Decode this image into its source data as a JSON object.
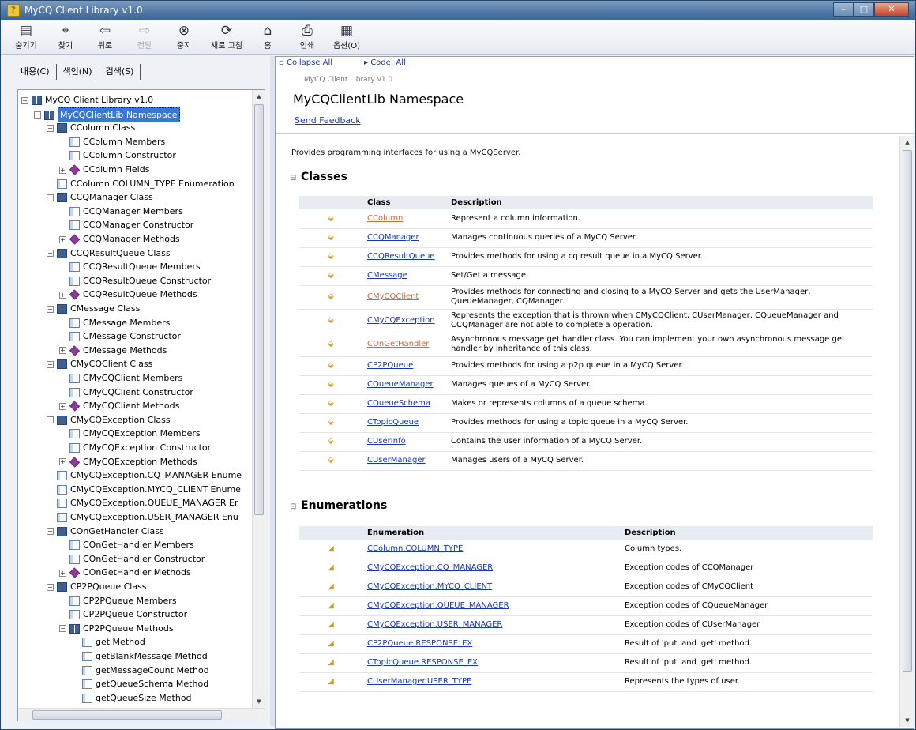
{
  "window": {
    "title": "MyCQ Client Library v1.0",
    "min": "–",
    "max": "□",
    "close": "✕"
  },
  "toolbar": {
    "buttons": [
      {
        "label": "숨기기",
        "icon": "hide-icon",
        "glyph": "▤"
      },
      {
        "label": "찾기",
        "icon": "locate-icon",
        "glyph": "⌖"
      },
      {
        "label": "뒤로",
        "icon": "back-icon",
        "glyph": "⇦"
      },
      {
        "label": "전달",
        "icon": "forward-icon",
        "glyph": "⇨"
      },
      {
        "label": "중지",
        "icon": "stop-icon",
        "glyph": "⊗"
      },
      {
        "label": "새로 고침",
        "icon": "refresh-icon",
        "glyph": "⟳"
      },
      {
        "label": "홈",
        "icon": "home-icon",
        "glyph": "⌂"
      },
      {
        "label": "인쇄",
        "icon": "print-icon",
        "glyph": "⎙"
      },
      {
        "label": "옵션(O)",
        "icon": "options-icon",
        "glyph": "▦"
      }
    ]
  },
  "nav_tabs": [
    "내용(C)",
    "색인(N)",
    "검색(S)"
  ],
  "tree": [
    {
      "d": 0,
      "type": "book",
      "exp": "−",
      "label": "MyCQ Client Library v1.0"
    },
    {
      "d": 1,
      "type": "book",
      "exp": "−",
      "label": "MyCQClientLib Namespace",
      "selected": true
    },
    {
      "d": 2,
      "type": "book",
      "exp": "−",
      "label": "CColumn Class"
    },
    {
      "d": 3,
      "type": "page",
      "label": "CColumn Members"
    },
    {
      "d": 3,
      "type": "page",
      "label": "CColumn Constructor"
    },
    {
      "d": 3,
      "type": "gem",
      "exp": "+",
      "label": "CColumn Fields"
    },
    {
      "d": 2,
      "type": "page",
      "label": "CColumn.COLUMN_TYPE Enumeration"
    },
    {
      "d": 2,
      "type": "book",
      "exp": "−",
      "label": "CCQManager Class"
    },
    {
      "d": 3,
      "type": "page",
      "label": "CCQManager Members"
    },
    {
      "d": 3,
      "type": "page",
      "label": "CCQManager Constructor"
    },
    {
      "d": 3,
      "type": "gem",
      "exp": "+",
      "label": "CCQManager Methods"
    },
    {
      "d": 2,
      "type": "book",
      "exp": "−",
      "label": "CCQResultQueue Class"
    },
    {
      "d": 3,
      "type": "page",
      "label": "CCQResultQueue Members"
    },
    {
      "d": 3,
      "type": "page",
      "label": "CCQResultQueue Constructor"
    },
    {
      "d": 3,
      "type": "gem",
      "exp": "+",
      "label": "CCQResultQueue Methods"
    },
    {
      "d": 2,
      "type": "book",
      "exp": "−",
      "label": "CMessage Class"
    },
    {
      "d": 3,
      "type": "page",
      "label": "CMessage Members"
    },
    {
      "d": 3,
      "type": "page",
      "label": "CMessage Constructor"
    },
    {
      "d": 3,
      "type": "gem",
      "exp": "+",
      "label": "CMessage Methods"
    },
    {
      "d": 2,
      "type": "book",
      "exp": "−",
      "label": "CMyCQClient Class"
    },
    {
      "d": 3,
      "type": "page",
      "label": "CMyCQClient Members"
    },
    {
      "d": 3,
      "type": "page",
      "label": "CMyCQClient Constructor"
    },
    {
      "d": 3,
      "type": "gem",
      "exp": "+",
      "label": "CMyCQClient Methods"
    },
    {
      "d": 2,
      "type": "book",
      "exp": "−",
      "label": "CMyCQException Class"
    },
    {
      "d": 3,
      "type": "page",
      "label": "CMyCQException Members"
    },
    {
      "d": 3,
      "type": "page",
      "label": "CMyCQException Constructor"
    },
    {
      "d": 3,
      "type": "gem",
      "exp": "+",
      "label": "CMyCQException Methods"
    },
    {
      "d": 2,
      "type": "page",
      "label": "CMyCQException.CQ_MANAGER Enume"
    },
    {
      "d": 2,
      "type": "page",
      "label": "CMyCQException.MYCQ_CLIENT Enume"
    },
    {
      "d": 2,
      "type": "page",
      "label": "CMyCQException.QUEUE_MANAGER Er"
    },
    {
      "d": 2,
      "type": "page",
      "label": "CMyCQException.USER_MANAGER Enu"
    },
    {
      "d": 2,
      "type": "book",
      "exp": "−",
      "label": "COnGetHandler Class"
    },
    {
      "d": 3,
      "type": "page",
      "label": "COnGetHandler Members"
    },
    {
      "d": 3,
      "type": "page",
      "label": "COnGetHandler Constructor"
    },
    {
      "d": 3,
      "type": "gem",
      "exp": "+",
      "label": "COnGetHandler Methods"
    },
    {
      "d": 2,
      "type": "book",
      "exp": "−",
      "label": "CP2PQueue Class"
    },
    {
      "d": 3,
      "type": "page",
      "label": "CP2PQueue Members"
    },
    {
      "d": 3,
      "type": "page",
      "label": "CP2PQueue Constructor"
    },
    {
      "d": 3,
      "type": "book",
      "exp": "−",
      "label": "CP2PQueue Methods"
    },
    {
      "d": 4,
      "type": "page",
      "label": "get Method"
    },
    {
      "d": 4,
      "type": "page",
      "label": "getBlankMessage Method"
    },
    {
      "d": 4,
      "type": "page",
      "label": "getMessageCount Method"
    },
    {
      "d": 4,
      "type": "page",
      "label": "getQueueSchema Method"
    },
    {
      "d": 4,
      "type": "page",
      "label": "getQueueSize Method"
    }
  ],
  "content": {
    "collapse_all": "Collapse All",
    "code_all": "Code: All",
    "library": "MyCQ Client Library v1.0",
    "title": "MyCQClientLib Namespace",
    "feedback": "Send Feedback",
    "intro": "Provides programming interfaces for using a MyCQServer.",
    "classes_heading": "Classes",
    "classes_cols": [
      "Class",
      "Description"
    ],
    "classes": [
      {
        "name": "CColumn",
        "desc": "Represent a column information.",
        "visited": true
      },
      {
        "name": "CCQManager",
        "desc": "Manages continuous queries of a MyCQ Server."
      },
      {
        "name": "CCQResultQueue",
        "desc": "Provides methods for using a cq result queue in a MyCQ Server."
      },
      {
        "name": "CMessage",
        "desc": "Set/Get a message."
      },
      {
        "name": "CMyCQClient",
        "desc": "Provides methods for connecting and closing to a MyCQ Server and gets the UserManager, QueueManager, CQManager.",
        "visited": true
      },
      {
        "name": "CMyCQException",
        "desc": "Represents the exception that is thrown when CMyCQClient, CUserManager, CQueueManager and CCQManager are not able to complete a operation."
      },
      {
        "name": "COnGetHandler",
        "desc": "Asynchronous message get handler class. You can implement your own asynchronous message get handler by inheritance of this class.",
        "visited": true
      },
      {
        "name": "CP2PQueue",
        "desc": "Provides methods for using a p2p queue in a MyCQ Server."
      },
      {
        "name": "CQueueManager",
        "desc": "Manages queues of a MyCQ Server."
      },
      {
        "name": "CQueueSchema",
        "desc": "Makes or represents columns of a queue schema."
      },
      {
        "name": "CTopicQueue",
        "desc": "Provides methods for using a topic queue in a MyCQ Server."
      },
      {
        "name": "CUserInfo",
        "desc": "Contains the user information of a MyCQ Server."
      },
      {
        "name": "CUserManager",
        "desc": "Manages users of a MyCQ Server."
      }
    ],
    "enums_heading": "Enumerations",
    "enums_cols": [
      "Enumeration",
      "Description"
    ],
    "enums": [
      {
        "name": "CColumn.COLUMN_TYPE",
        "desc": "Column types."
      },
      {
        "name": "CMyCQException.CQ_MANAGER",
        "desc": "Exception codes of CCQManager"
      },
      {
        "name": "CMyCQException.MYCQ_CLIENT",
        "desc": "Exception codes of CMyCQClient"
      },
      {
        "name": "CMyCQException.QUEUE_MANAGER",
        "desc": "Exception codes of CQueueManager"
      },
      {
        "name": "CMyCQException.USER_MANAGER",
        "desc": "Exception codes of CUserManager"
      },
      {
        "name": "CP2PQueue.RESPONSE_EX",
        "desc": "Result of 'put' and 'get' method."
      },
      {
        "name": "CTopicQueue.RESPONSE_EX",
        "desc": "Result of 'put' and 'get' method."
      },
      {
        "name": "CUserManager.USER_TYPE",
        "desc": "Represents the types of user."
      }
    ]
  }
}
